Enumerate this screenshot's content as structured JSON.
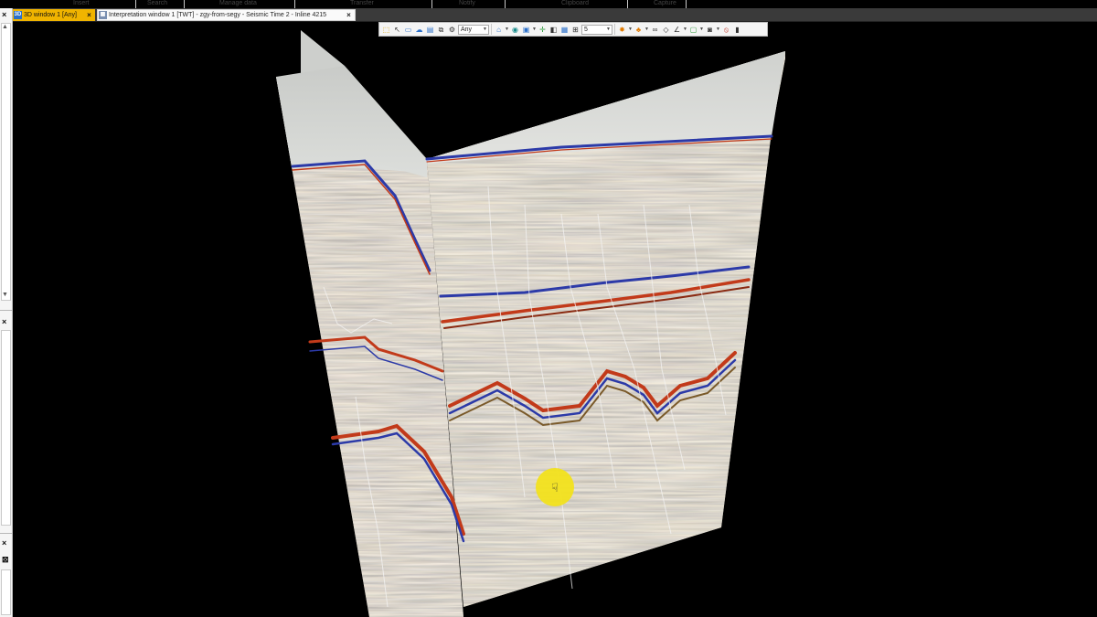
{
  "ribbon": {
    "groups": [
      "Insert",
      "Search",
      "Manage data",
      "Transfer",
      "Notify",
      "Clipboard",
      "Capture"
    ]
  },
  "tabs": [
    {
      "icon_text": "3D",
      "label": "3D window 1 [Any]",
      "active": true
    },
    {
      "icon_text": "",
      "label": "Interpretation window 1 [TWT] - zgy-from-segy - Seismic Time 2 - Inline 4215",
      "active": false
    }
  ],
  "toolbar": {
    "domain_select": "Any",
    "value_select": "5"
  },
  "icons": {
    "close": "close-icon",
    "pin": "pin-icon",
    "cursor": "pointer-hand-cursor"
  },
  "colors": {
    "active_tab": "#f0b400",
    "viewport_background": "#000000",
    "cursor_highlight": "#f2e21c",
    "horizon_red": "#c23a1a",
    "horizon_blue": "#2c3aa8"
  }
}
